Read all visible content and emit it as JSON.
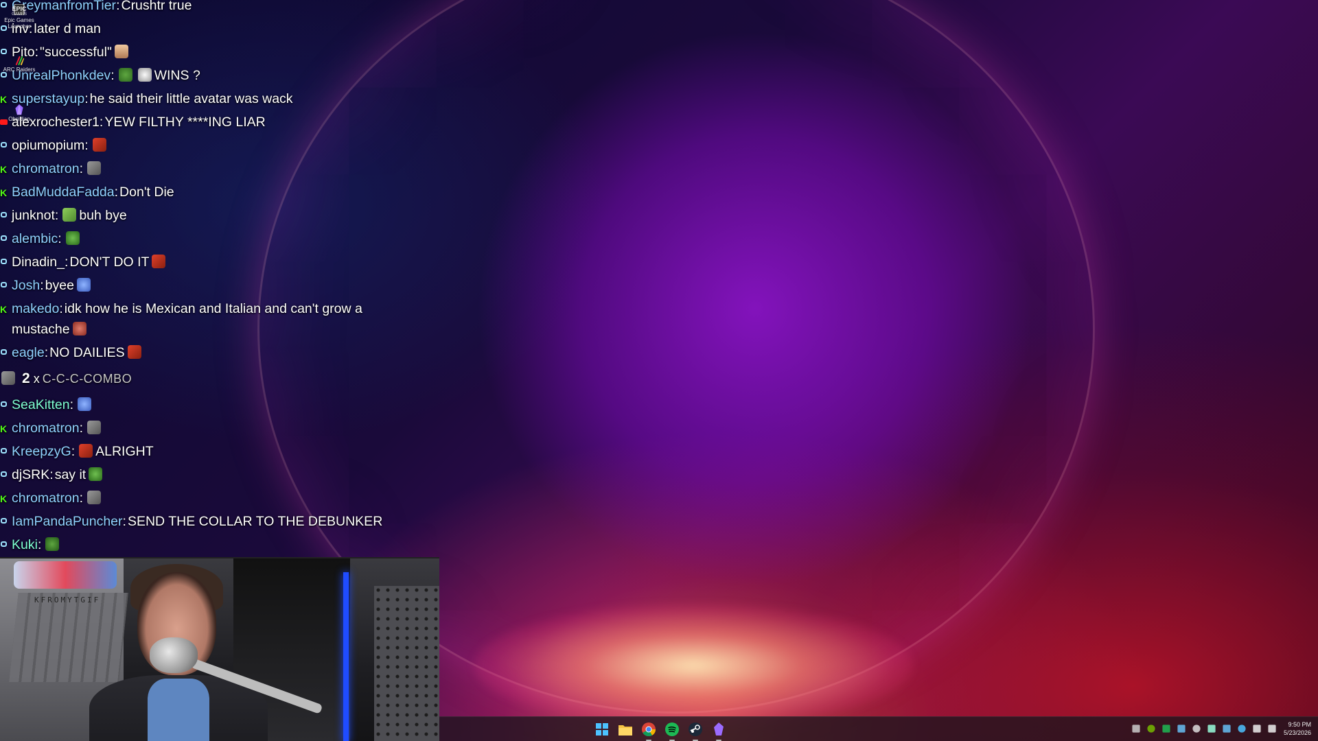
{
  "desktop_icons": [
    {
      "name": "epic-games-launcher-icon",
      "label_lines": [
        "EPIC",
        "GAMES",
        "Epic Games",
        "Launcher"
      ]
    },
    {
      "name": "arc-raiders-icon",
      "label": "ARC Raiders"
    },
    {
      "name": "obsidian-icon",
      "label": "Obsidian"
    }
  ],
  "chat": {
    "messages": [
      {
        "platform": "twitch",
        "user": "GreymanfromTier",
        "color": "#8fd1ff",
        "text": "Crushtr true",
        "emotes": []
      },
      {
        "platform": "twitch",
        "user": "inv",
        "color": "#ffffff",
        "text": "later d man",
        "emotes": []
      },
      {
        "platform": "twitch",
        "user": "Pito",
        "color": "#ffffff",
        "text": "\"successful\"",
        "emotes": [
          "face-emote"
        ]
      },
      {
        "platform": "twitch",
        "user": "UnrealPhonkdev",
        "color": "#8fd1ff",
        "text": "WINS ?",
        "emotes_before": [
          "frog-emote",
          "skull-emote"
        ]
      },
      {
        "platform": "kick",
        "user": "superstayup",
        "color": "#8fd1ff",
        "text": "he said their little avatar was wack"
      },
      {
        "platform": "youtube",
        "user": "alexrochester1",
        "color": "#ffffff",
        "text": "YEW FILTHY ****ING LIAR"
      },
      {
        "platform": "twitch",
        "user": "opiumopium",
        "color": "#ffffff",
        "text": "",
        "emotes": [
          "hammer-emote"
        ]
      },
      {
        "platform": "kick",
        "user": "chromatron",
        "color": "#8fd1ff",
        "text": "",
        "emotes": [
          "gun-emote"
        ]
      },
      {
        "platform": "kick",
        "user": "BadMuddaFadda",
        "color": "#8fd1ff",
        "text": "Don't Die"
      },
      {
        "platform": "twitch",
        "user": "junknot",
        "color": "#ffffff",
        "text": "buh bye",
        "emotes_before": [
          "wave-emote"
        ]
      },
      {
        "platform": "twitch",
        "user": "alembic",
        "color": "#8fd1ff",
        "text": "",
        "emotes": [
          "pepe-emote"
        ]
      },
      {
        "platform": "twitch",
        "user": "Dinadin_",
        "color": "#ffffff",
        "text": "DON'T DO IT",
        "emotes": [
          "hammer-emote"
        ]
      },
      {
        "platform": "twitch",
        "user": "Josh",
        "color": "#8fd1ff",
        "text": "byee",
        "emotes": [
          "blue-face-emote"
        ]
      },
      {
        "platform": "kick",
        "user": "makedo",
        "color": "#8fd1ff",
        "text": "idk how he is Mexican and Italian and can't grow a mustache",
        "emotes": [
          "mustache-emote"
        ],
        "wrap": true
      },
      {
        "platform": "twitch",
        "user": "eagle",
        "color": "#8fd1ff",
        "text": "NO DAILIES",
        "emotes": [
          "hammer-emote"
        ]
      }
    ],
    "combo": {
      "count": "2",
      "x": "x",
      "text": "C-C-C-COMBO"
    },
    "messages_after": [
      {
        "platform": "twitch",
        "user": "SeaKitten",
        "color": "#7fffd4",
        "text": "",
        "emotes": [
          "blue-face-emote"
        ]
      },
      {
        "platform": "kick",
        "user": "chromatron",
        "color": "#8fd1ff",
        "text": "",
        "emotes": [
          "gun-emote"
        ]
      },
      {
        "platform": "twitch",
        "user": "KreepzyG",
        "color": "#8fd1ff",
        "text": "ALRIGHT",
        "emotes_before": [
          "hammer-emote"
        ]
      },
      {
        "platform": "twitch",
        "user": "djSRK",
        "color": "#ffffff",
        "text": "say it",
        "emotes": [
          "pepe-emote"
        ]
      },
      {
        "platform": "kick",
        "user": "chromatron",
        "color": "#8fd1ff",
        "text": "",
        "emotes": [
          "gun-emote"
        ]
      },
      {
        "platform": "twitch",
        "user": "IamPandaPuncher",
        "color": "#8fd1ff",
        "text": "SEND THE COLLAR TO THE DEBUNKER"
      },
      {
        "platform": "twitch",
        "user": "Kuki",
        "color": "#7fffd4",
        "text": "",
        "emotes": [
          "small-frog-emote"
        ]
      }
    ]
  },
  "webcam": {
    "keyboard_text": "KFROMYTGIF"
  },
  "taskbar": {
    "apps": [
      {
        "name": "windows-start-icon",
        "active": false
      },
      {
        "name": "file-explorer-icon",
        "active": false
      },
      {
        "name": "chrome-icon",
        "active": true
      },
      {
        "name": "spotify-icon",
        "active": true
      },
      {
        "name": "steam-icon",
        "active": true
      },
      {
        "name": "obsidian-icon",
        "active": true
      }
    ],
    "tray_icons": [
      "chevron-up-icon",
      "nvidia-icon",
      "spotify-tray-icon",
      "steam-tray-icon",
      "refresh-icon",
      "security-icon",
      "steam-icon",
      "bluetooth-icon",
      "network-icon",
      "volume-icon"
    ],
    "time": "9:50 PM",
    "date": "5/23/2026"
  },
  "colors": {
    "twitch_accent": "#9fe5ff",
    "kick_accent": "#53fc18",
    "youtube_accent": "#ff1a1a",
    "name_blue": "#8fd1ff",
    "name_teal": "#7fffd4"
  }
}
